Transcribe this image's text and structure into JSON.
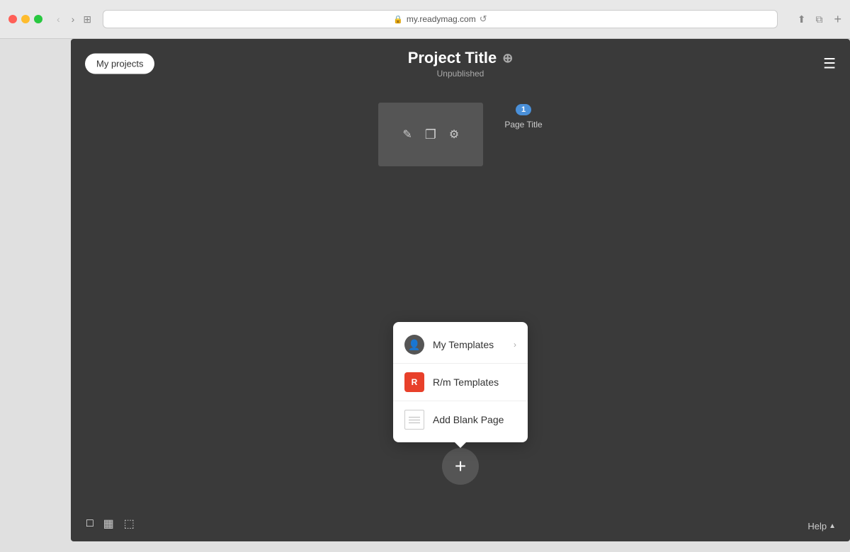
{
  "browser": {
    "url": "my.readymag.com",
    "back_label": "‹",
    "forward_label": "›",
    "tab_icon": "⊞",
    "reload_label": "↺",
    "plus_label": "+"
  },
  "header": {
    "my_projects_label": "My projects",
    "project_title": "Project Title",
    "settings_icon": "⊕",
    "status": "Unpublished",
    "menu_icon": "☰"
  },
  "page_card": {
    "number": "1",
    "title": "Page Title",
    "edit_icon": "✎",
    "copy_icon": "❐",
    "gear_icon": "⚙"
  },
  "add_button": {
    "label": "+"
  },
  "popup": {
    "my_templates_label": "My Templates",
    "my_templates_icon": "👤",
    "rm_templates_label": "R/m Templates",
    "rm_templates_icon": "R",
    "add_blank_label": "Add Blank Page",
    "chevron": "›"
  },
  "bottom_bar": {
    "view1_icon": "□",
    "view2_icon": "▦",
    "view3_icon": "⬚",
    "help_label": "Help",
    "help_arrow": "▲"
  }
}
